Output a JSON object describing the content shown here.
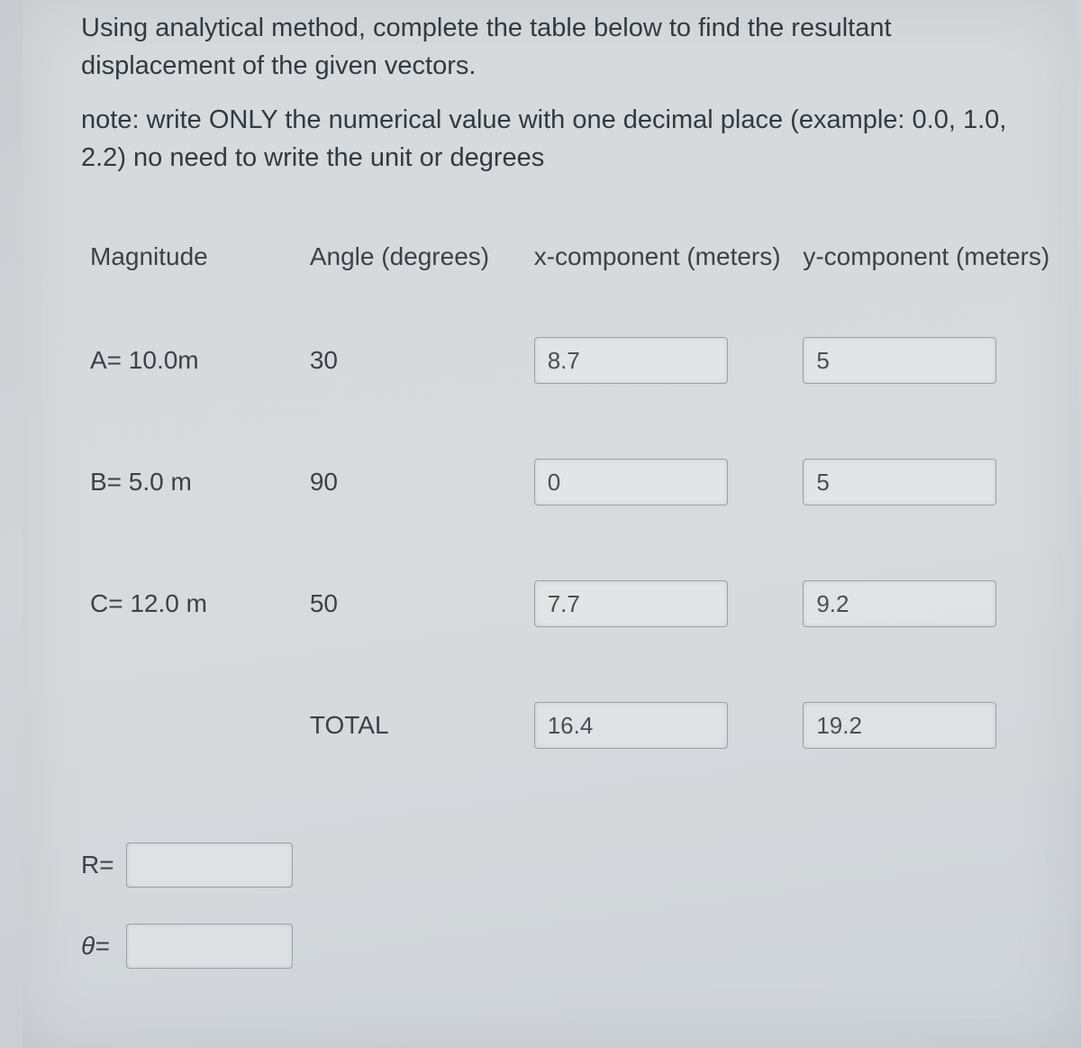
{
  "intro": {
    "line1": "Using analytical method, complete the table below to find the resultant displacement of the given vectors.",
    "line2": "note: write ONLY the numerical value with one decimal place (example: 0.0, 1.0, 2.2) no need to write the unit or degrees"
  },
  "headers": {
    "magnitude": "Magnitude",
    "angle": "Angle (degrees)",
    "xcomp": "x-component (meters)",
    "ycomp": "y-component (meters)"
  },
  "rows": {
    "a": {
      "mag": "A= 10.0m",
      "ang": "30",
      "x": "8.7",
      "y": "5"
    },
    "b": {
      "mag": "B= 5.0 m",
      "ang": "90",
      "x": "0",
      "y": "5"
    },
    "c": {
      "mag": "C= 12.0 m",
      "ang": "50",
      "x": "7.7",
      "y": "9.2"
    },
    "total": {
      "label": "TOTAL",
      "x": "16.4",
      "y": "19.2"
    }
  },
  "answers": {
    "r_label": "R=",
    "r_value": "",
    "theta_label": "θ=",
    "theta_value": ""
  }
}
